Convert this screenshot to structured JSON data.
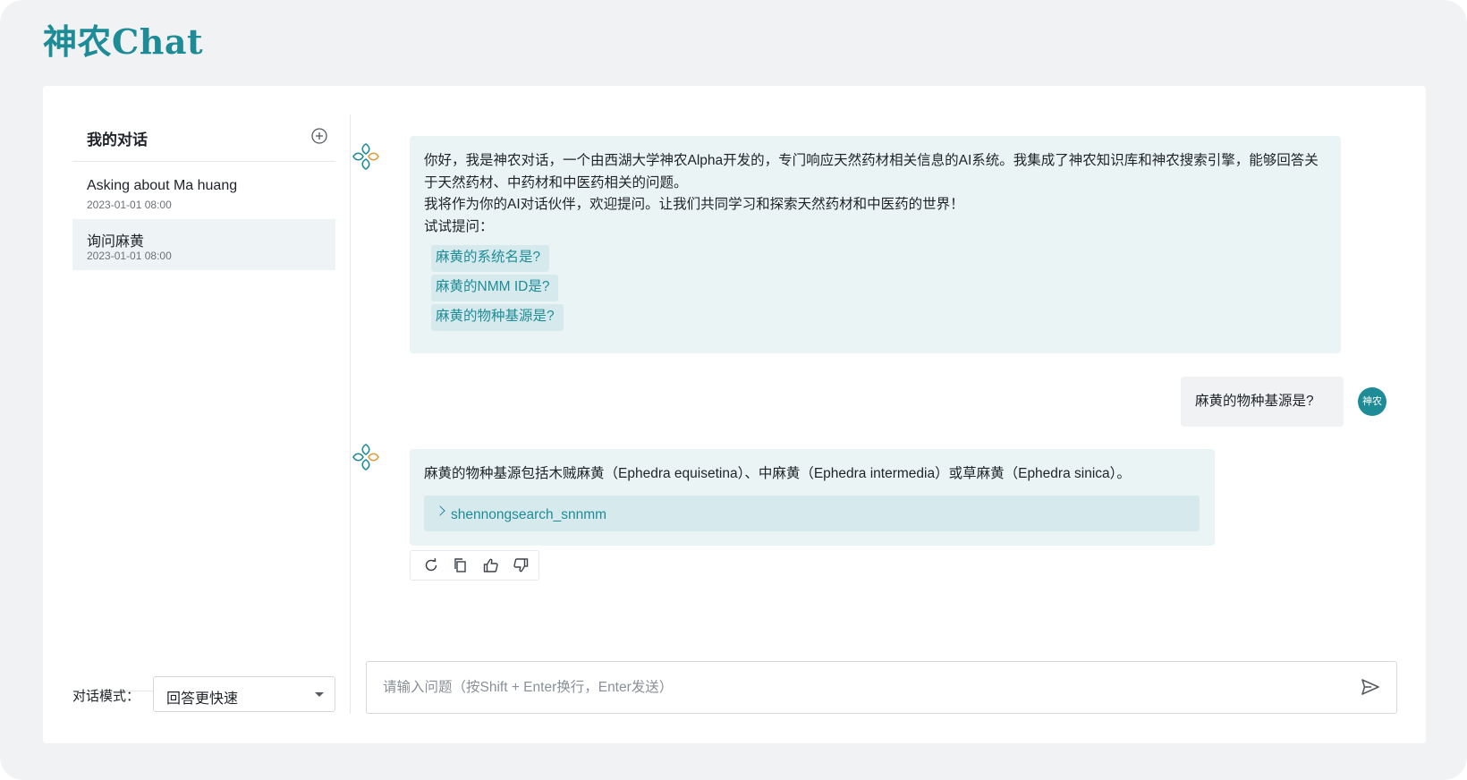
{
  "app": {
    "logo": "神农Chat"
  },
  "sidebar": {
    "title": "我的对话",
    "conversations": [
      {
        "title": "Asking about Ma huang",
        "time": "2023-01-01 08:00",
        "active": false
      },
      {
        "title": "询问麻黄",
        "time": "2023-01-01 08:00",
        "active": true
      }
    ],
    "mode_label": "对话模式：",
    "mode_value": "回答更快速"
  },
  "chat": {
    "welcome": {
      "line1": "你好，我是神农对话，一个由西湖大学神农Alpha开发的，专门响应天然药材相关信息的AI系统。我集成了神农知识库和神农搜索引擎，能够回答关于天然药材、中药材和中医药相关的问题。",
      "line2": "我将作为你的AI对话伙伴，欢迎提问。让我们共同学习和探索天然药材和中医药的世界！",
      "line3": "试试提问：",
      "suggestions": [
        "麻黄的系统名是?",
        "麻黄的NMM ID是?",
        "麻黄的物种基源是?"
      ]
    },
    "user_message": "麻黄的物种基源是?",
    "user_avatar_text": "神农",
    "answer": "麻黄的物种基源包括木贼麻黄（Ephedra equisetina）、中麻黄（Ephedra intermedia）或草麻黄（Ephedra sinica）。",
    "tool_call": "shennongsearch_snnmm",
    "input_placeholder": "请输入问题（按Shift + Enter换行，Enter发送）"
  },
  "colors": {
    "brand": "#1e8c96",
    "bot_bubble": "#eaf4f5",
    "chip": "#d6eaed"
  }
}
